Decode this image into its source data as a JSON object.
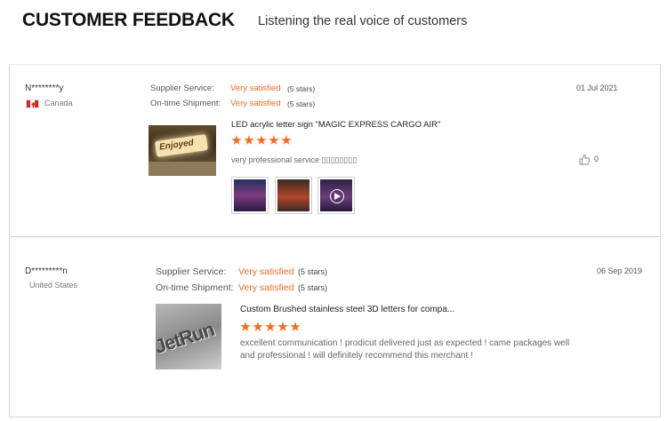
{
  "header": {
    "title": "CUSTOMER FEEDBACK",
    "subtitle": "Listening the real voice of  customers"
  },
  "reviews": [
    {
      "reviewer": "N********y",
      "country": "Canada",
      "flag_icon": "canada-flag-icon",
      "supplier_service_label": "Supplier Service:",
      "supplier_service_value": "Very satisfied",
      "supplier_service_stars": "(5 stars)",
      "shipment_label": "On-time Shipment:",
      "shipment_value": "Very satisfied",
      "shipment_stars": "(5 stars)",
      "date": "01 Jul 2021",
      "product_title": "LED acrylic letter sign \"MAGIC EXPRESS CARGO AIR\"",
      "rating": 5,
      "comment": "very professional service ▯▯▯▯▯▯▯▯",
      "like_count": "0",
      "attachments": [
        "photo-1",
        "photo-2",
        "video-1"
      ]
    },
    {
      "reviewer": "D*********n",
      "country": "United States",
      "supplier_service_label": "Supplier Service:",
      "supplier_service_value": "Very satisfied",
      "supplier_service_stars": "(5 stars)",
      "shipment_label": "On-time Shipment:",
      "shipment_value": "Very satisfied",
      "shipment_stars": "(5 stars)",
      "date": "06 Sep 2019",
      "product_title": "Custom Brushed stainless steel 3D letters for compa...",
      "rating": 5,
      "comment": "excellent communication ! prodicut delivered just as expected ! came packages well and professional ! will definitely recommend this merchant !"
    }
  ],
  "colors": {
    "accent": "#ee6b1f",
    "star": "#f26b1d",
    "border": "#d6d6d6"
  }
}
